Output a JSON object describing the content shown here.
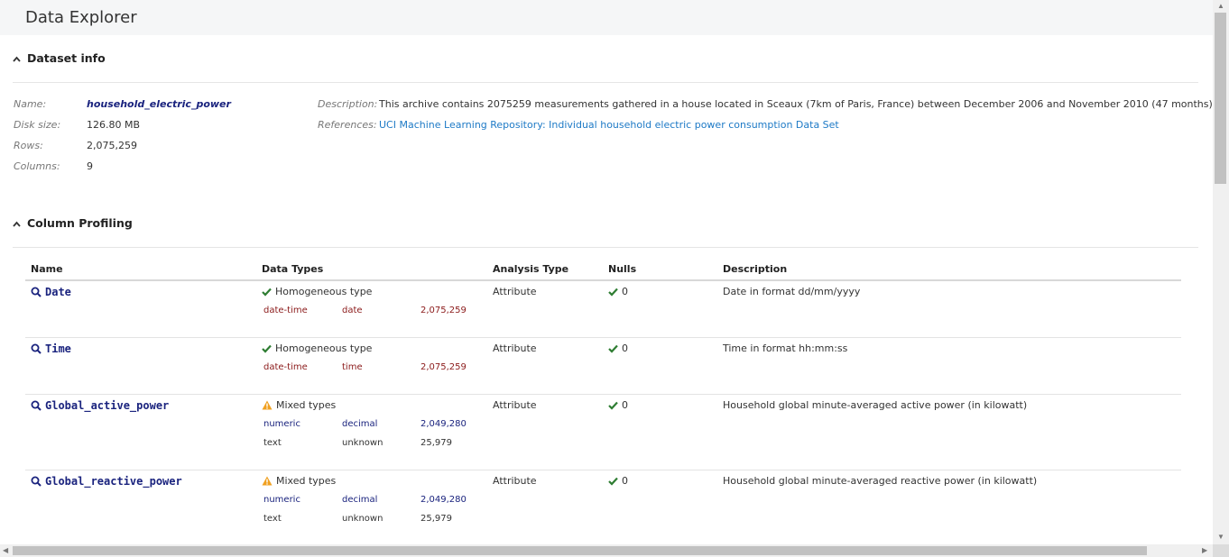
{
  "window": {
    "title": "Data Explorer"
  },
  "dataset_info": {
    "header": "Dataset info",
    "name_label": "Name:",
    "name": "household_electric_power",
    "disk_label": "Disk size:",
    "disk": "126.80 MB",
    "rows_label": "Rows:",
    "rows": "2,075,259",
    "columns_label": "Columns:",
    "columns": "9",
    "description_label": "Description:",
    "description": "This archive contains 2075259 measurements gathered in a house located in Sceaux (7km of Paris, France) between December 2006 and November 2010 (47 months)",
    "references_label": "References:",
    "references": "UCI Machine Learning Repository: Individual household electric power consumption Data Set"
  },
  "profiling": {
    "header": "Column Profiling",
    "headers": {
      "name": "Name",
      "types": "Data Types",
      "analysis": "Analysis Type",
      "nulls": "Nulls",
      "description": "Description"
    },
    "rows": [
      {
        "name": "Date",
        "type_status": "Homogeneous type",
        "type_icon": "check-icon",
        "types": [
          {
            "t1": "date-time",
            "t2": "date",
            "count": "2,075,259"
          }
        ],
        "analysis": "Attribute",
        "nulls": "0",
        "description": "Date in format dd/mm/yyyy"
      },
      {
        "name": "Time",
        "type_status": "Homogeneous type",
        "type_icon": "check-icon",
        "types": [
          {
            "t1": "date-time",
            "t2": "time",
            "count": "2,075,259"
          }
        ],
        "analysis": "Attribute",
        "nulls": "0",
        "description": "Time in format hh:mm:ss"
      },
      {
        "name": "Global_active_power",
        "type_status": "Mixed types",
        "type_icon": "warning-icon",
        "types": [
          {
            "t1": "numeric",
            "t2": "decimal",
            "count": "2,049,280"
          },
          {
            "t1": "text",
            "t2": "unknown",
            "count": "25,979"
          }
        ],
        "analysis": "Attribute",
        "nulls": "0",
        "description": "Household global minute-averaged active power (in kilowatt)"
      },
      {
        "name": "Global_reactive_power",
        "type_status": "Mixed types",
        "type_icon": "warning-icon",
        "types": [
          {
            "t1": "numeric",
            "t2": "decimal",
            "count": "2,049,280"
          },
          {
            "t1": "text",
            "t2": "unknown",
            "count": "25,979"
          }
        ],
        "analysis": "Attribute",
        "nulls": "0",
        "description": "Household global minute-averaged reactive power (in kilowatt)"
      }
    ]
  },
  "colors": {
    "check": "#2e7d32",
    "warning": "#f0a020",
    "link": "#1e7ac6",
    "name": "#1a237e",
    "datetime": "#8b1a1a"
  }
}
